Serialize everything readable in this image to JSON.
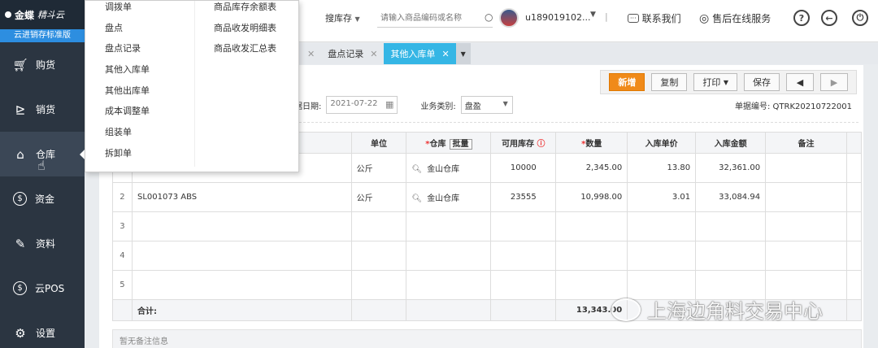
{
  "sidebar": {
    "logo_brand": "金蝶",
    "logo_product": "精斗云",
    "edition": "云进销存标准版",
    "items": [
      {
        "label": "购货",
        "icon": "cart-icon"
      },
      {
        "label": "销货",
        "icon": "sales-icon"
      },
      {
        "label": "仓库",
        "icon": "warehouse-icon"
      },
      {
        "label": "资金",
        "icon": "money-icon"
      },
      {
        "label": "资料",
        "icon": "pen-icon"
      },
      {
        "label": "云POS",
        "icon": "pos-icon"
      },
      {
        "label": "设置",
        "icon": "gear-icon"
      }
    ]
  },
  "dropdown": {
    "col1": [
      "调拨单",
      "盘点",
      "盘点记录",
      "其他入库单",
      "其他出库单",
      "成本调整单",
      "组装单",
      "拆卸单"
    ],
    "col2": [
      "商品库存余额表",
      "商品收发明细表",
      "商品收发汇总表"
    ]
  },
  "topbar": {
    "search_type": "搜库存",
    "search_placeholder": "请输入商品编码或名称",
    "user": "u189019102...",
    "contact": "联系我们",
    "service": "售后在线服务",
    "help": "?"
  },
  "tabs": [
    {
      "label": "盘点记录",
      "active": false
    },
    {
      "label": "其他入库单",
      "active": true
    }
  ],
  "toolbar": {
    "new": "新增",
    "copy": "复制",
    "print": "打印",
    "save": "保存"
  },
  "form": {
    "date_label": "据日期:",
    "date_value": "2021-07-22",
    "biz_label": "业务类别:",
    "biz_value": "盘盈",
    "docno_label": "单据编号:",
    "docno_value": "QTRK20210722001"
  },
  "table": {
    "headers": {
      "unit": "单位",
      "warehouse": "仓库",
      "batch": "批量",
      "available": "可用库存",
      "qty": "数量",
      "price": "入库单价",
      "amount": "入库金额",
      "remark": "备注"
    },
    "rows": [
      {
        "idx": "",
        "name": "",
        "unit": "公斤",
        "warehouse": "金山仓库",
        "available": "10000",
        "qty": "2,345.00",
        "price": "13.80",
        "amount": "32,361.00"
      },
      {
        "idx": "2",
        "name": "SL001073 ABS",
        "unit": "公斤",
        "warehouse": "金山仓库",
        "available": "23555",
        "qty": "10,998.00",
        "price": "3.01",
        "amount": "33,084.94"
      },
      {
        "idx": "3"
      },
      {
        "idx": "4"
      },
      {
        "idx": "5"
      }
    ],
    "total_label": "合计:",
    "total_qty": "13,343.00"
  },
  "remark_placeholder": "暂无备注信息",
  "watermark": "上海边角料交易中心"
}
